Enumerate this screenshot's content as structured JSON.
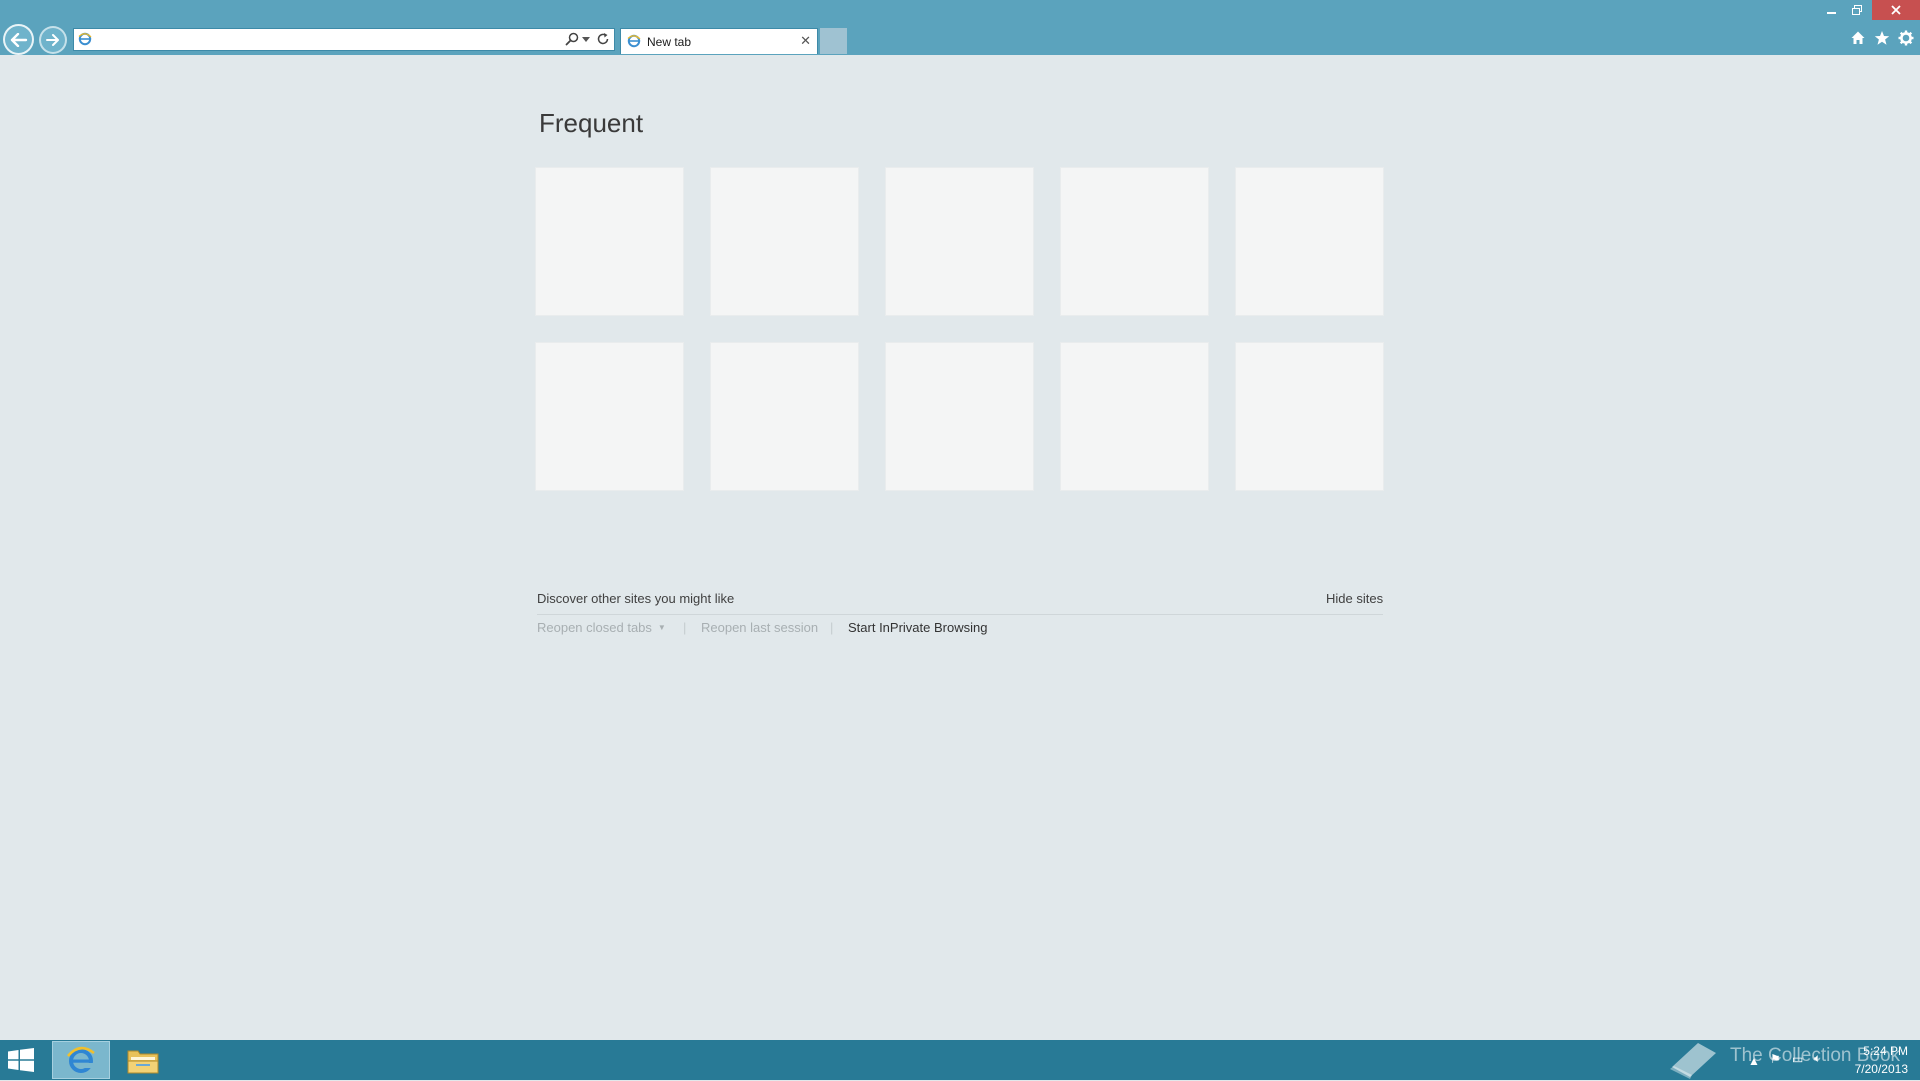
{
  "browser": {
    "address": {
      "value": "",
      "placeholder": ""
    },
    "tabs": [
      {
        "label": "New tab"
      }
    ],
    "colors": {
      "chrome": "#5ba3bd",
      "close": "#c75050",
      "taskbar": "#287a96",
      "page": "#e1e8eb"
    }
  },
  "content": {
    "heading": "Frequent",
    "tile_count": 10,
    "discover": "Discover other sites you might like",
    "hide_sites": "Hide sites",
    "links": {
      "reopen_closed_tabs": "Reopen closed tabs",
      "reopen_last_session": "Reopen last session",
      "start_inprivate": "Start InPrivate Browsing",
      "separator": "|"
    }
  },
  "taskbar": {
    "watermark": "The Collection Book",
    "clock_time": "5:24 PM",
    "clock_date": "7/20/2013"
  },
  "icons": [
    "back-icon",
    "forward-icon",
    "ie-logo-icon",
    "search-icon",
    "dropdown-icon",
    "refresh-icon",
    "close-icon",
    "home-icon",
    "star-icon",
    "gear-icon",
    "windows-logo-icon",
    "folder-icon",
    "book-icon"
  ]
}
